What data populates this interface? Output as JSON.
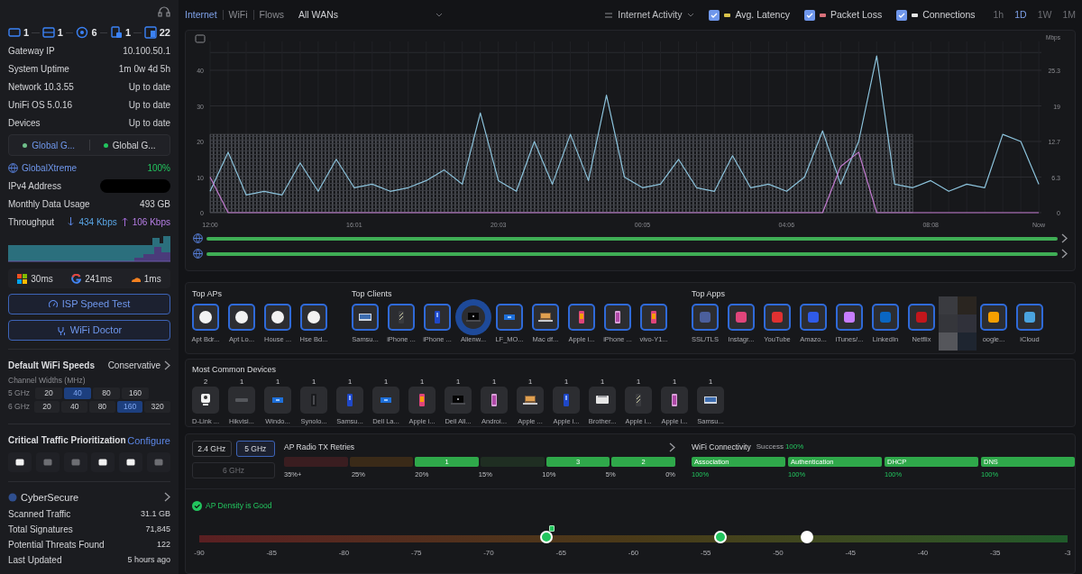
{
  "sidebar": {
    "topology": [
      {
        "kind": "gateway",
        "count": "1"
      },
      {
        "kind": "switch",
        "count": "1"
      },
      {
        "kind": "ap",
        "count": "6"
      },
      {
        "kind": "wired",
        "count": "1"
      },
      {
        "kind": "wireless",
        "count": "22"
      }
    ],
    "info_rows": [
      {
        "label": "Gateway IP",
        "value": "10.100.50.1"
      },
      {
        "label": "System Uptime",
        "value": "1m 0w 4d 5h"
      },
      {
        "label": "Network 10.3.55",
        "value": "Up to date"
      },
      {
        "label": "UniFi OS 5.0.16",
        "value": "Up to date"
      },
      {
        "label": "Devices",
        "value": "Up to date"
      }
    ],
    "wan_tabs": [
      {
        "label": "Global G...",
        "selected": true
      },
      {
        "label": "Global G...",
        "selected": false
      }
    ],
    "isp": {
      "name": "GlobalXtreme",
      "uptime": "100%"
    },
    "ipv4": {
      "label": "IPv4 Address",
      "redacted": true
    },
    "data_usage": {
      "label": "Monthly Data Usage",
      "value": "493 GB"
    },
    "throughput": {
      "label": "Throughput",
      "down": "434 Kbps",
      "up": "106 Kbps"
    },
    "latency": [
      {
        "kind": "windows",
        "value": "30ms"
      },
      {
        "kind": "google",
        "value": "241ms"
      },
      {
        "kind": "cloud",
        "value": "1ms"
      }
    ],
    "buttons": [
      {
        "kind": "speed",
        "label": "ISP Speed Test"
      },
      {
        "kind": "doctor",
        "label": "WiFi Doctor"
      }
    ],
    "wifi_speeds": {
      "title": "Default WiFi Speeds",
      "value": "Conservative",
      "subtitle": "Channel Widths (MHz)",
      "bands": [
        {
          "label": "5 GHz",
          "widths": [
            {
              "label": "20",
              "selected": false
            },
            {
              "label": "40",
              "selected": true
            },
            {
              "label": "80",
              "selected": false
            },
            {
              "label": "160",
              "selected": false
            }
          ]
        },
        {
          "label": "6 GHz",
          "widths": [
            {
              "label": "20",
              "selected": false
            },
            {
              "label": "40",
              "selected": false
            },
            {
              "label": "80",
              "selected": false
            },
            {
              "label": "160",
              "selected": true
            },
            {
              "label": "320",
              "selected": false
            }
          ]
        }
      ]
    },
    "traffic": {
      "title": "Critical Traffic Prioritization",
      "action": "Configure",
      "apps": [
        {
          "active": true
        },
        {
          "active": false
        },
        {
          "active": false
        },
        {
          "active": true
        },
        {
          "active": true
        },
        {
          "active": false
        }
      ]
    },
    "cybersecure": {
      "title": "CyberSecure",
      "rows": [
        {
          "label": "Scanned Traffic",
          "value": "31.1 GB"
        },
        {
          "label": "Total Signatures",
          "value": "71,845"
        },
        {
          "label": "Potential Threats Found",
          "value": "122"
        },
        {
          "label": "Last Updated",
          "value": "5 hours ago"
        }
      ]
    }
  },
  "toolbar": {
    "tabs": [
      {
        "label": "Internet",
        "selected": true
      },
      {
        "label": "WiFi",
        "selected": false
      },
      {
        "label": "Flows",
        "selected": false
      }
    ],
    "wan_select": "All WANs",
    "view_select": "Internet Activity",
    "toggles": [
      {
        "checked": true,
        "color": "#d9c24a"
      },
      {
        "checked": true,
        "color": "#d9707a"
      },
      {
        "checked": true,
        "color": "#e5e5e5"
      }
    ],
    "ranges": [
      {
        "label": "1h",
        "selected": false
      },
      {
        "label": "1D",
        "selected": true
      },
      {
        "label": "1W",
        "selected": false
      },
      {
        "label": "1M",
        "selected": false
      }
    ]
  },
  "activity": {
    "right_axis": {
      "unit": "Mbps",
      "labels": [
        "25.3",
        "19",
        "12.7",
        "6.3",
        "0"
      ]
    },
    "chart_data": {
      "type": "line",
      "categories": [
        "12:00",
        null,
        null,
        null,
        null,
        null,
        null,
        null,
        "16:01",
        null,
        null,
        null,
        null,
        null,
        null,
        null,
        "20:03",
        null,
        null,
        null,
        null,
        null,
        null,
        null,
        "00:05",
        null,
        null,
        null,
        null,
        null,
        null,
        null,
        "04:06",
        null,
        null,
        null,
        null,
        null,
        null,
        null,
        "08:08",
        null,
        null,
        null,
        null,
        null,
        "Now"
      ],
      "yticks": [
        0,
        10,
        20,
        30,
        40
      ],
      "ylim": [
        0,
        45
      ],
      "grid": true,
      "series": [
        {
          "name": "Avg. Latency",
          "type": "line",
          "color": "#8cc3dc",
          "values": [
            6,
            17,
            5,
            6,
            5,
            14,
            6,
            15,
            7,
            8,
            6,
            7,
            9,
            12,
            8,
            28,
            9,
            6,
            20,
            8,
            22,
            9,
            33,
            10,
            7,
            8,
            15,
            7,
            6,
            16,
            7,
            8,
            6,
            10,
            23,
            8,
            20,
            44,
            8,
            7,
            9,
            6,
            8,
            7,
            22,
            20,
            8
          ]
        },
        {
          "name": "Packet Loss",
          "type": "line",
          "color": "#c27bd0",
          "values": [
            10,
            0,
            0,
            0,
            0,
            0,
            0,
            0,
            0,
            0,
            0,
            0,
            0,
            0,
            0,
            0,
            0,
            0,
            0,
            0,
            0,
            0,
            0,
            0,
            0,
            0,
            0,
            0,
            0,
            0,
            0,
            0,
            0,
            0,
            0,
            13,
            17,
            0,
            0,
            0,
            0,
            0,
            0,
            0,
            0,
            0,
            0
          ]
        },
        {
          "name": "Connections",
          "type": "area",
          "color": "#5a5c62",
          "values": [
            22,
            22,
            22,
            22,
            22,
            22,
            22,
            22,
            22,
            22,
            22,
            22,
            22,
            22,
            22,
            22,
            22,
            22,
            22,
            22,
            22,
            22,
            22,
            22,
            22,
            22,
            22,
            22,
            22,
            22,
            22,
            22,
            22,
            22,
            22,
            22,
            22,
            22,
            22,
            22,
            null,
            null,
            null,
            null,
            null,
            null,
            null
          ]
        }
      ]
    },
    "wan_bars": [
      {
        "level": 1
      },
      {
        "level": 1
      }
    ]
  },
  "top_aps": {
    "title": "Top APs",
    "items": [
      {
        "kind": "ap",
        "label": "Apt Bdr..."
      },
      {
        "kind": "ap",
        "label": "Apt Lo..."
      },
      {
        "kind": "ap",
        "label": "House ..."
      },
      {
        "kind": "ap",
        "label": "Hse Bd..."
      }
    ]
  },
  "top_clients": {
    "title": "Top Clients",
    "items": [
      {
        "kind": "tv",
        "label": "Samsu...",
        "selected": false
      },
      {
        "kind": "phone-dark",
        "label": "iPhone ...",
        "selected": false
      },
      {
        "kind": "phone-blue",
        "label": "iPhone ...",
        "selected": false
      },
      {
        "kind": "laptop-dark",
        "label": "Alienw...",
        "selected": true
      },
      {
        "kind": "box",
        "label": "LF_MO...",
        "selected": false
      },
      {
        "kind": "laptop",
        "label": "Mac df...",
        "selected": false
      },
      {
        "kind": "phone",
        "label": "Apple i...",
        "selected": false
      },
      {
        "kind": "phone-pink",
        "label": "iPhone ...",
        "selected": false
      },
      {
        "kind": "phone",
        "label": "vivo-Y1...",
        "selected": false
      }
    ]
  },
  "top_apps": {
    "title": "Top Apps",
    "items": [
      {
        "kind": "app",
        "label": "SSL/TLS",
        "color": "#4b5f9c"
      },
      {
        "kind": "app",
        "label": "Instagr...",
        "color": "#e0457b"
      },
      {
        "kind": "app",
        "label": "YouTube",
        "color": "#e03131"
      },
      {
        "kind": "app",
        "label": "Amazo...",
        "color": "#2f5be8"
      },
      {
        "kind": "app",
        "label": "iTunes/...",
        "color": "#c77dff"
      },
      {
        "kind": "app",
        "label": "LinkedIn",
        "color": "#0a66c2"
      },
      {
        "kind": "app",
        "label": "Netflix",
        "color": "#c3161c"
      },
      {
        "kind": "redacted"
      },
      {
        "kind": "app",
        "label": "oogle...",
        "color": "#f59f00"
      },
      {
        "kind": "app",
        "label": "iCloud",
        "color": "#4aa3df"
      }
    ]
  },
  "common_devices": {
    "title": "Most Common Devices",
    "items": [
      {
        "kind": "camera",
        "count": "2",
        "label": "D-Link ..."
      },
      {
        "kind": "nvr",
        "count": "1",
        "label": "Hikvisi..."
      },
      {
        "kind": "box",
        "count": "1",
        "label": "Windo..."
      },
      {
        "kind": "nas",
        "count": "1",
        "label": "Synolo..."
      },
      {
        "kind": "phone-blue",
        "count": "1",
        "label": "Samsu..."
      },
      {
        "kind": "box",
        "count": "1",
        "label": "Dell La..."
      },
      {
        "kind": "phone",
        "count": "1",
        "label": "Apple i..."
      },
      {
        "kind": "laptop-dark",
        "count": "1",
        "label": "Dell All..."
      },
      {
        "kind": "phone-pink",
        "count": "1",
        "label": "Androi..."
      },
      {
        "kind": "laptop",
        "count": "1",
        "label": "Apple ..."
      },
      {
        "kind": "phone-blue",
        "count": "1",
        "label": "Apple i..."
      },
      {
        "kind": "printer",
        "count": "1",
        "label": "Brother..."
      },
      {
        "kind": "phone-dark",
        "count": "1",
        "label": "Apple i..."
      },
      {
        "kind": "phone-pink",
        "count": "1",
        "label": "Apple i..."
      },
      {
        "kind": "tv",
        "count": "1",
        "label": "Samsu..."
      }
    ]
  },
  "bands": [
    {
      "label": "2.4 GHz",
      "selected": false,
      "disabled": false
    },
    {
      "label": "5 GHz",
      "selected": true,
      "disabled": false
    },
    {
      "label": "6 GHz",
      "selected": false,
      "disabled": true
    }
  ],
  "tx_retries": {
    "title": "AP Radio TX Retries",
    "segments": [
      {
        "filled": false
      },
      {
        "filled": false
      },
      {
        "filled": true,
        "count": "1"
      },
      {
        "filled": false
      },
      {
        "filled": true,
        "count": "3"
      },
      {
        "filled": true,
        "count": "2"
      }
    ],
    "scale": [
      "35%+",
      "25%",
      "20%",
      "15%",
      "10%",
      "5%",
      "0%"
    ]
  },
  "connectivity": {
    "title": "WiFi Connectivity",
    "success_label": "Success",
    "success": "100%",
    "stages": [
      {
        "label": "Association",
        "value": "100%"
      },
      {
        "label": "Authentication",
        "value": "100%"
      },
      {
        "label": "DHCP",
        "value": "100%"
      },
      {
        "label": "DNS",
        "value": "100%"
      }
    ]
  },
  "density": {
    "status": "AP Density is Good",
    "markers": [
      {
        "level": 0.4,
        "color": "#22c55e",
        "badge": true
      },
      {
        "level": 0.6,
        "color": "#22c55e",
        "badge": false
      },
      {
        "level": 0.7,
        "color": "#ffffff",
        "badge": false
      }
    ],
    "ticks": [
      "-90",
      "-85",
      "-80",
      "-75",
      "-70",
      "-65",
      "-60",
      "-55",
      "-50",
      "-45",
      "-40",
      "-35",
      "-3"
    ]
  }
}
